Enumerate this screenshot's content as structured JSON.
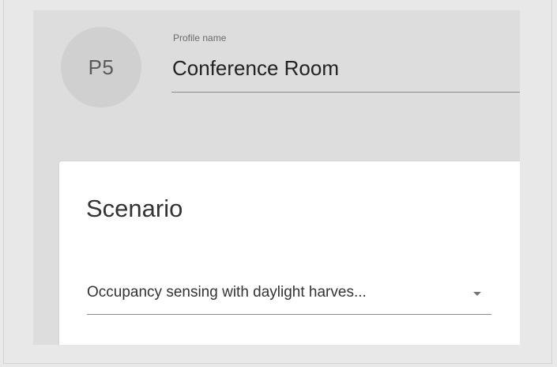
{
  "profile": {
    "avatar_initials": "P5",
    "name_label": "Profile name",
    "name_value": "Conference Room"
  },
  "scenario": {
    "title": "Scenario",
    "selected_value": "Occupancy sensing with daylight harves...",
    "dropdown_icon": "triangle-down"
  }
}
